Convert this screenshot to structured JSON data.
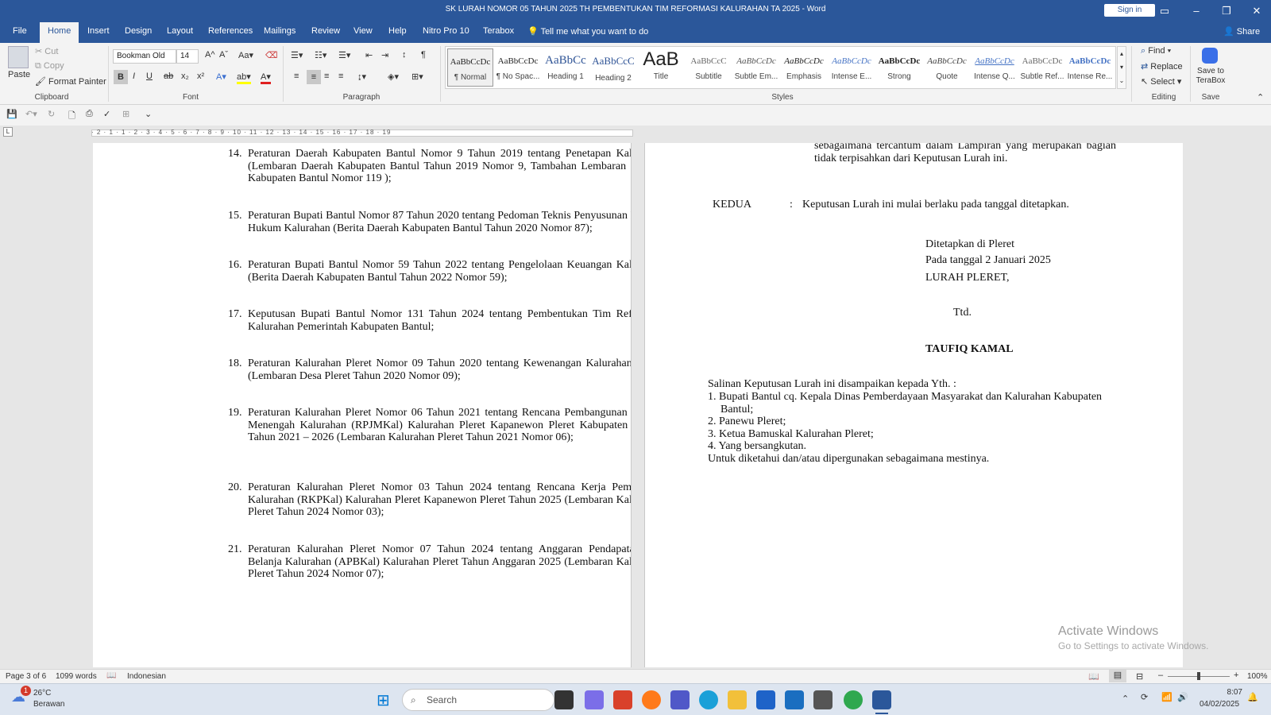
{
  "window": {
    "title": "SK LURAH NOMOR 05 TAHUN 2025 TH PEMBENTUKAN TIM REFORMASI KALURAHAN TA 2025  -  Word",
    "sign_in": "Sign in"
  },
  "tabs": [
    "File",
    "Home",
    "Insert",
    "Design",
    "Layout",
    "References",
    "Mailings",
    "Review",
    "View",
    "Help",
    "Nitro Pro 10",
    "Terabox"
  ],
  "tell_me": "Tell me what you want to do",
  "share": "Share",
  "clipboard": {
    "paste": "Paste",
    "cut": "Cut",
    "copy": "Copy",
    "format_painter": "Format Painter",
    "label": "Clipboard"
  },
  "font": {
    "name": "Bookman Old",
    "size": "14",
    "label": "Font"
  },
  "paragraph": {
    "label": "Paragraph"
  },
  "styles": {
    "label": "Styles",
    "items": [
      {
        "preview": "AaBbCcDc",
        "name": "¶ Normal"
      },
      {
        "preview": "AaBbCcDc",
        "name": "¶ No Spac..."
      },
      {
        "preview": "AaBbCc",
        "name": "Heading 1"
      },
      {
        "preview": "AaBbCcC",
        "name": "Heading 2"
      },
      {
        "preview": "AaB",
        "name": "Title"
      },
      {
        "preview": "AaBbCcC",
        "name": "Subtitle"
      },
      {
        "preview": "AaBbCcDc",
        "name": "Subtle Em..."
      },
      {
        "preview": "AaBbCcDc",
        "name": "Emphasis"
      },
      {
        "preview": "AaBbCcDc",
        "name": "Intense E..."
      },
      {
        "preview": "AaBbCcDc",
        "name": "Strong"
      },
      {
        "preview": "AaBbCcDc",
        "name": "Quote"
      },
      {
        "preview": "AaBbCcDc",
        "name": "Intense Q..."
      },
      {
        "preview": "AaBbCcDc",
        "name": "Subtle Ref..."
      },
      {
        "preview": "AaBbCcDc",
        "name": "Intense Re..."
      }
    ]
  },
  "editing": {
    "find": "Find",
    "replace": "Replace",
    "select": "Select",
    "label": "Editing"
  },
  "save_group": {
    "button": "Save to TeraBox",
    "label": "Save"
  },
  "ruler_numbers": "· 2 · 1 · 1 · 2 · 3 · 4 · 5 · 6 · 7 · 8 · 9 · 10 · 11 · 12 · 13 · 14 · 15 · 16 · 17 · 18 · 19",
  "page1_items": [
    {
      "num": "14.",
      "text": "Peraturan Daerah Kabupaten Bantul Nomor 9 Tahun 2019 tentang Penetapan Kalurahan (Lembaran Daerah Kabupaten Bantul Tahun 2019 Nomor 9, Tambahan Lembaran Daerah Kabupaten Bantul Nomor 119 );"
    },
    {
      "num": "15.",
      "text": "Peraturan Bupati Bantul Nomor 87 Tahun 2020 tentang Pedoman Teknis Penyusunan Produk Hukum Kalurahan (Berita Daerah Kabupaten Bantul Tahun 2020 Nomor 87);"
    },
    {
      "num": "16.",
      "text": "Peraturan Bupati Bantul Nomor 59 Tahun 2022 tentang Pengelolaan Keuangan Kalurahan (Berita Daerah Kabupaten Bantul Tahun 2022 Nomor 59);"
    },
    {
      "num": "17.",
      "text": "Keputusan Bupati Bantul Nomor 131 Tahun 2024 tentang Pembentukan Tim Reformasi Kalurahan Pemerintah Kabupaten Bantul;"
    },
    {
      "num": "18.",
      "text": "Peraturan Kalurahan Pleret Nomor 09 Tahun 2020 tentang Kewenangan Kalurahan Pleret (Lembaran Desa Pleret Tahun 2020 Nomor 09);"
    },
    {
      "num": "19.",
      "text": "Peraturan Kalurahan Pleret Nomor 06 Tahun 2021 tentang Rencana Pembangunan Jangka Menengah Kalurahan (RPJMKal) Kalurahan Pleret Kapanewon Pleret Kabupaten Bantul Tahun 2021 – 2026 (Lembaran Kalurahan Pleret Tahun 2021 Nomor 06);"
    },
    {
      "num": "20.",
      "text": "Peraturan Kalurahan Pleret Nomor 03 Tahun 2024 tentang Rencana Kerja Pemerintah Kalurahan (RKPKal) Kalurahan Pleret Kapanewon Pleret Tahun 2025 (Lembaran Kalurahan Pleret Tahun 2024 Nomor 03);"
    },
    {
      "num": "21.",
      "text": "Peraturan Kalurahan Pleret Nomor 07 Tahun 2024 tentang Anggaran Pendapatan dan Belanja Kalurahan (APBKal) Kalurahan Pleret Tahun Anggaran 2025 (Lembaran Kalurahan Pleret Tahun 2024 Nomor 07);"
    }
  ],
  "page2": {
    "top_text": "sebagaimana tercantum dalam Lampiran yang merupakan bagian tidak terpisahkan dari Keputusan Lurah ini.",
    "kedua_label": "KEDUA",
    "colon": ":",
    "kedua_text": "Keputusan Lurah ini mulai berlaku pada tanggal ditetapkan.",
    "ditetapkan": "Ditetapkan di Pleret",
    "pada_tanggal": "Pada tanggal 2 Januari 2025",
    "lurah": "LURAH PLERET,",
    "ttd": "Ttd.",
    "nama": "TAUFIQ KAMAL",
    "salinan": "Salinan Keputusan Lurah ini disampaikan kepada Yth. :",
    "recipients": [
      "1. Bupati Bantul cq. Kepala Dinas Pemberdayaan Masyarakat dan Kalurahan Kabupaten Bantul;",
      "2. Panewu Pleret;",
      "3. Ketua Bamuskal Kalurahan Pleret;",
      "4. Yang bersangkutan."
    ],
    "closing": "Untuk diketahui dan/atau dipergunakan sebagaimana mestinya."
  },
  "watermark": {
    "title": "Activate Windows",
    "sub": "Go to Settings to activate Windows."
  },
  "status": {
    "page": "Page 3 of 6",
    "words": "1099 words",
    "language": "Indonesian",
    "zoom": "100%"
  },
  "taskbar": {
    "temp": "26°C",
    "weather": "Berawan",
    "badge": "1",
    "search": "Search",
    "time": "8:07",
    "date": "04/02/2025"
  }
}
